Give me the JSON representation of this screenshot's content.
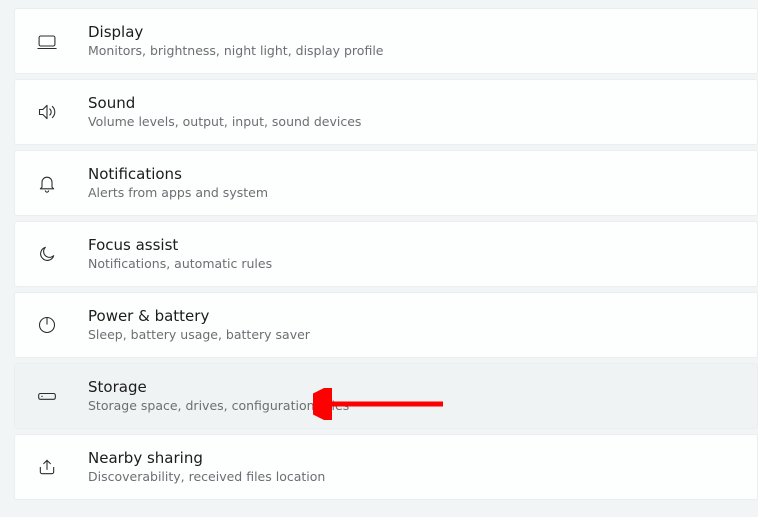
{
  "settings": {
    "items": [
      {
        "key": "display",
        "title": "Display",
        "desc": "Monitors, brightness, night light, display profile"
      },
      {
        "key": "sound",
        "title": "Sound",
        "desc": "Volume levels, output, input, sound devices"
      },
      {
        "key": "notifications",
        "title": "Notifications",
        "desc": "Alerts from apps and system"
      },
      {
        "key": "focus-assist",
        "title": "Focus assist",
        "desc": "Notifications, automatic rules"
      },
      {
        "key": "power-battery",
        "title": "Power & battery",
        "desc": "Sleep, battery usage, battery saver"
      },
      {
        "key": "storage",
        "title": "Storage",
        "desc": "Storage space, drives, configuration rules"
      },
      {
        "key": "nearby-sharing",
        "title": "Nearby sharing",
        "desc": "Discoverability, received files location"
      }
    ]
  },
  "annotation": {
    "target": "storage",
    "color": "#ff0000"
  }
}
